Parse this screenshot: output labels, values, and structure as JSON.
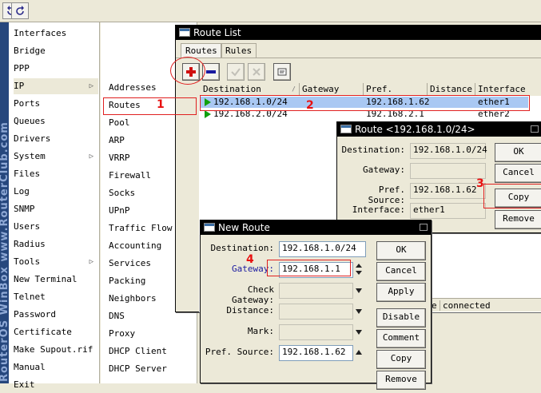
{
  "main_menu": [
    {
      "label": "Interfaces",
      "arrow": false
    },
    {
      "label": "Bridge",
      "arrow": false
    },
    {
      "label": "PPP",
      "arrow": false
    },
    {
      "label": "IP",
      "arrow": true
    },
    {
      "label": "Ports",
      "arrow": false
    },
    {
      "label": "Queues",
      "arrow": false
    },
    {
      "label": "Drivers",
      "arrow": false
    },
    {
      "label": "System",
      "arrow": true
    },
    {
      "label": "Files",
      "arrow": false
    },
    {
      "label": "Log",
      "arrow": false
    },
    {
      "label": "SNMP",
      "arrow": false
    },
    {
      "label": "Users",
      "arrow": false
    },
    {
      "label": "Radius",
      "arrow": false
    },
    {
      "label": "Tools",
      "arrow": true
    },
    {
      "label": "New Terminal",
      "arrow": false
    },
    {
      "label": "Telnet",
      "arrow": false
    },
    {
      "label": "Password",
      "arrow": false
    },
    {
      "label": "Certificate",
      "arrow": false
    },
    {
      "label": "Make Supout.rif",
      "arrow": false
    },
    {
      "label": "Manual",
      "arrow": false
    },
    {
      "label": "Exit",
      "arrow": false
    }
  ],
  "sub_menu": [
    "Addresses",
    "Routes",
    "Pool",
    "ARP",
    "VRRP",
    "Firewall",
    "Socks",
    "UPnP",
    "Traffic Flow",
    "Accounting",
    "Services",
    "Packing",
    "Neighbors",
    "DNS",
    "Proxy",
    "DHCP Client",
    "DHCP Server"
  ],
  "brand_text": "RouterOS WinBox  www.RouterClub.com",
  "route_list": {
    "title": "Route List",
    "tabs": [
      "Routes",
      "Rules"
    ],
    "columns": [
      "Destination",
      "Gateway",
      "Pref. Source",
      "Distance",
      "Interface"
    ],
    "rows": [
      {
        "destination": "192.168.1.0/24",
        "gateway": "",
        "pref_source": "192.168.1.62",
        "distance": "",
        "interface": "ether1"
      },
      {
        "destination": "192.168.2.0/24",
        "gateway": "",
        "pref_source": "192.168.2.1",
        "distance": "",
        "interface": "ether2"
      }
    ],
    "status_text": "connected",
    "status_prefix": "e"
  },
  "route_detail": {
    "title": "Route <192.168.1.0/24>",
    "destination_label": "Destination:",
    "destination": "192.168.1.0/24",
    "gateway_label": "Gateway:",
    "gateway": "",
    "pref_source_label": "Pref. Source:",
    "pref_source": "192.168.1.62",
    "interface_label": "Interface:",
    "interface": "ether1",
    "buttons": {
      "ok": "OK",
      "cancel": "Cancel",
      "copy": "Copy",
      "remove": "Remove"
    }
  },
  "new_route": {
    "title": "New Route",
    "destination_label": "Destination:",
    "destination": "192.168.1.0/24",
    "gateway_label": "Gateway:",
    "gateway": "192.168.1.1",
    "check_gateway_label": "Check Gateway:",
    "distance_label": "Distance:",
    "mark_label": "Mark:",
    "pref_source_label": "Pref. Source:",
    "pref_source": "192.168.1.62",
    "buttons": {
      "ok": "OK",
      "cancel": "Cancel",
      "apply": "Apply",
      "disable": "Disable",
      "comment": "Comment",
      "copy": "Copy",
      "remove": "Remove"
    }
  },
  "annotations": [
    "1",
    "2",
    "3",
    "4"
  ],
  "colors": {
    "selection": "#a9c8f3",
    "title_bar": "#000000",
    "annotation": "#e02020",
    "brand_strip": "#26477d"
  }
}
